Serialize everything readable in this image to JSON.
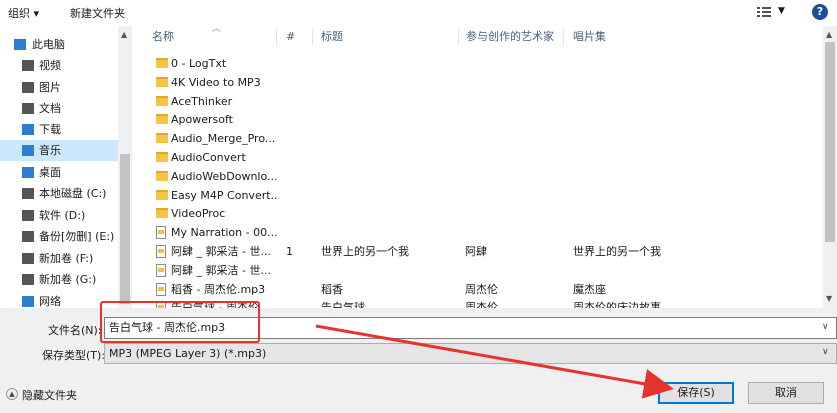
{
  "toolbar": {
    "organize_label": "组织 ▾",
    "new_folder_label": "新建文件夹",
    "help_icon_text": "?"
  },
  "sidebar": {
    "items": [
      {
        "label": "此电脑",
        "icon": "computer-icon",
        "color": "#2d7dd2"
      },
      {
        "label": "视频",
        "icon": "video-icon",
        "color": "#555555"
      },
      {
        "label": "图片",
        "icon": "picture-icon",
        "color": "#555555"
      },
      {
        "label": "文档",
        "icon": "document-icon",
        "color": "#555555"
      },
      {
        "label": "下载",
        "icon": "download-icon",
        "color": "#2d7dd2"
      },
      {
        "label": "音乐",
        "icon": "music-icon",
        "color": "#2d7dd2"
      },
      {
        "label": "桌面",
        "icon": "desktop-icon",
        "color": "#2d7dd2"
      },
      {
        "label": "本地磁盘 (C:)",
        "icon": "drive-icon",
        "color": "#555555"
      },
      {
        "label": "软件 (D:)",
        "icon": "drive-icon",
        "color": "#555555"
      },
      {
        "label": "备份[勿删] (E:)",
        "icon": "drive-icon",
        "color": "#555555"
      },
      {
        "label": "新加卷 (F:)",
        "icon": "drive-icon",
        "color": "#555555"
      },
      {
        "label": "新加卷 (G:)",
        "icon": "drive-icon",
        "color": "#555555"
      },
      {
        "label": "网络",
        "icon": "network-icon",
        "color": "#2d7dd2"
      }
    ],
    "selected_index": 5
  },
  "list": {
    "columns": {
      "name": "名称",
      "num": "#",
      "title": "标题",
      "artist": "参与创作的艺术家",
      "album": "唱片集"
    },
    "rows": [
      {
        "type": "folder",
        "name": "0 - LogTxt",
        "num": "",
        "title": "",
        "artist": "",
        "album": ""
      },
      {
        "type": "folder",
        "name": "4K Video to MP3",
        "num": "",
        "title": "",
        "artist": "",
        "album": ""
      },
      {
        "type": "folder",
        "name": "AceThinker",
        "num": "",
        "title": "",
        "artist": "",
        "album": ""
      },
      {
        "type": "folder",
        "name": "Apowersoft",
        "num": "",
        "title": "",
        "artist": "",
        "album": ""
      },
      {
        "type": "folder",
        "name": "Audio_Merge_Pro...",
        "num": "",
        "title": "",
        "artist": "",
        "album": ""
      },
      {
        "type": "folder",
        "name": "AudioConvert",
        "num": "",
        "title": "",
        "artist": "",
        "album": ""
      },
      {
        "type": "folder",
        "name": "AudioWebDownlo...",
        "num": "",
        "title": "",
        "artist": "",
        "album": ""
      },
      {
        "type": "folder",
        "name": "Easy M4P Convert...",
        "num": "",
        "title": "",
        "artist": "",
        "album": ""
      },
      {
        "type": "folder",
        "name": "VideoProc",
        "num": "",
        "title": "",
        "artist": "",
        "album": ""
      },
      {
        "type": "file",
        "name": "My Narration - 00...",
        "num": "",
        "title": "",
        "artist": "",
        "album": ""
      },
      {
        "type": "file",
        "name": "阿肆 _ 郭采洁 - 世...",
        "num": "1",
        "title": "世界上的另一个我",
        "artist": "阿肆",
        "album": "世界上的另一个我"
      },
      {
        "type": "file",
        "name": "阿肆 _ 郭采洁 - 世...",
        "num": "",
        "title": "",
        "artist": "",
        "album": ""
      },
      {
        "type": "file",
        "name": "稻香 - 周杰伦.mp3",
        "num": "",
        "title": "稻香",
        "artist": "周杰伦",
        "album": "魔杰座"
      },
      {
        "type": "file",
        "name": "告白气球 - 周杰伦...",
        "num": "",
        "title": "告白气球",
        "artist": "周杰伦",
        "album": "周杰伦的床边故事"
      }
    ]
  },
  "form": {
    "filename_label": "文件名(N):",
    "filename_value": "告白气球 - 周杰伦.mp3",
    "filetype_label": "保存类型(T):",
    "filetype_value": "MP3 (MPEG Layer 3) (*.mp3)"
  },
  "footer": {
    "hide_folders_label": "隐藏文件夹",
    "save_label": "保存(S)",
    "cancel_label": "取消"
  },
  "colors": {
    "accent": "#0078d7",
    "annotation_red": "#e8322d",
    "selection": "#cce8ff"
  }
}
